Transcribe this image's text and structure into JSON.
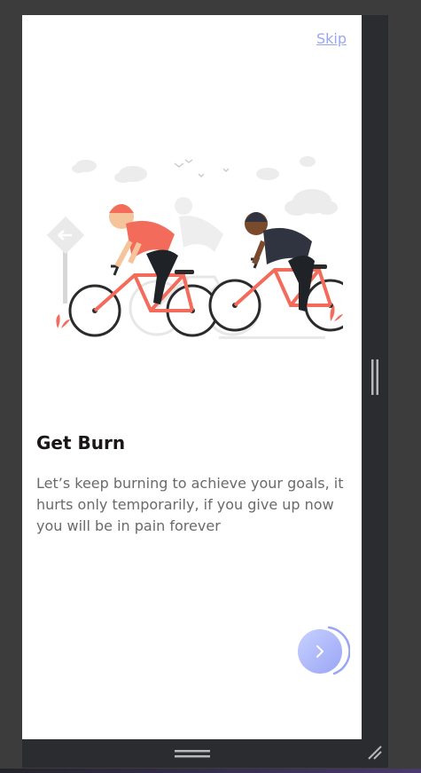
{
  "onboarding": {
    "skip_label": "Skip",
    "title": "Get Burn",
    "description": "Let’s keep burning to achieve your goals, it hurts only temporarily, if you give up now you will be in pain forever"
  },
  "illustration": {
    "icon": "cyclists-illustration"
  },
  "next_button": {
    "icon": "chevron-right-icon"
  },
  "colors": {
    "accent": "#9aa6f5",
    "title": "#1d1617",
    "body_text": "#6a6a6a",
    "bike_red": "#f26b5b"
  }
}
